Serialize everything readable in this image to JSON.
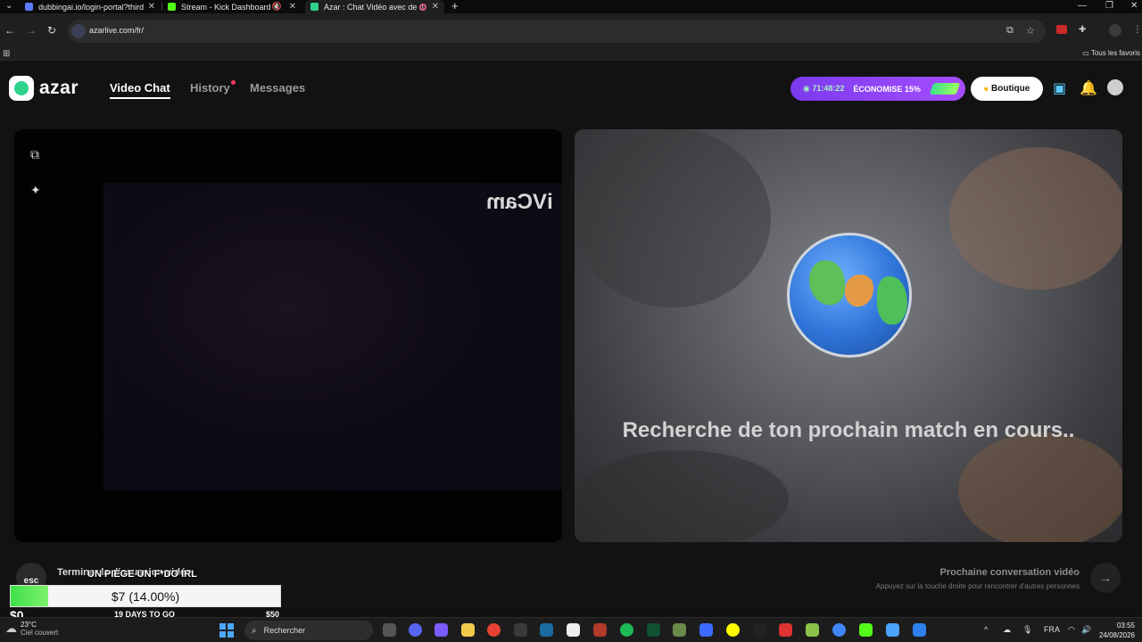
{
  "browser": {
    "tabs": [
      {
        "title": "dubbingai.io/login-portal?third",
        "active": false
      },
      {
        "title": "Stream - Kick Dashboard",
        "active": false
      },
      {
        "title": "Azar : Chat Vidéo avec de n",
        "active": true
      }
    ],
    "new_tab_glyph": "+",
    "url": "azarlive.com/fr/",
    "bookmarks_all": "Tous les favoris"
  },
  "azar": {
    "logo_text": "azar",
    "nav": {
      "video_chat": "Video Chat",
      "history": "History",
      "messages": "Messages"
    },
    "promo": {
      "timer": "71:48:22",
      "label": "ÉCONOMISE 15%"
    },
    "shop_label": "Boutique",
    "self_view_watermark": "iVCam",
    "searching_text": "Recherche de ton prochain match en cours..",
    "end_chat": {
      "key": "esc",
      "label": "Terminer la discussion vidéo"
    },
    "next_chat": {
      "title": "Prochaine conversation vidéo",
      "subtitle": "Appuyez sur la touche droite pour rencontrer d'autres personnes"
    }
  },
  "donation_goal": {
    "title": "UN PIEGE UN F*DO IRL",
    "amount_label": "$7 (14.00%)",
    "progress_fraction": 0.14,
    "min_label": "$0",
    "days_label": "19 DAYS TO GO",
    "max_label": "$50"
  },
  "taskbar": {
    "weather_temp": "23°C",
    "weather_desc": "Ciel couvert",
    "search_placeholder": "Rechercher",
    "language": "FRA",
    "time": "03:55",
    "date": "24/08/2026"
  },
  "colors": {
    "brand_green": "#2fd18b",
    "promo_purple": "#7c3aed",
    "goal_green": "#3fe14a",
    "notification_red": "#ff3b5c"
  }
}
